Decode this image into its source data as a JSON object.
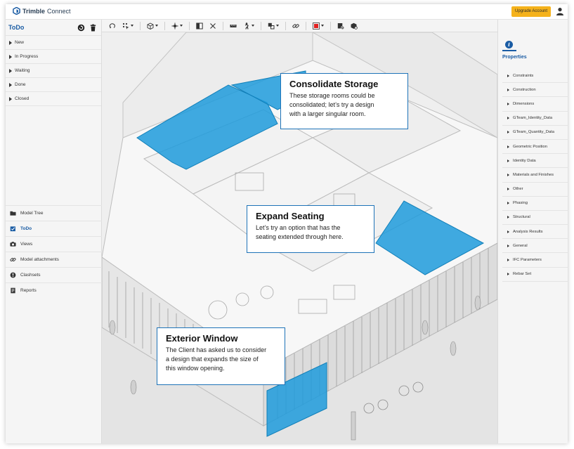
{
  "header": {
    "brand_name": "Trimble",
    "brand_product": "Connect",
    "upgrade_label": "Upgrade Account",
    "accent": "#f5b21b",
    "brand_color": "#1a5ca4"
  },
  "left_panel": {
    "title": "ToDo",
    "header_icons": [
      "refresh-icon",
      "trash-icon"
    ],
    "todo_groups": [
      {
        "label": "New"
      },
      {
        "label": "In Progress"
      },
      {
        "label": "Waiting"
      },
      {
        "label": "Done"
      },
      {
        "label": "Closed"
      }
    ],
    "nav": [
      {
        "label": "Model Tree",
        "icon": "folder-icon"
      },
      {
        "label": "ToDo",
        "icon": "todo-icon",
        "active": true
      },
      {
        "label": "Views",
        "icon": "camera-icon"
      },
      {
        "label": "Model attachments",
        "icon": "link-icon"
      },
      {
        "label": "Clashsets",
        "icon": "clash-icon"
      },
      {
        "label": "Reports",
        "icon": "report-icon"
      }
    ]
  },
  "toolbar": {
    "icons": [
      "orbit-icon",
      "select-icon",
      "cube-icon",
      "center-icon",
      "section-icon",
      "close-icon",
      "measure-icon",
      "walk-icon",
      "markup-icon",
      "link-icon",
      "color-icon",
      "clear-icon",
      "model-icon"
    ],
    "markup_color": "#e02020"
  },
  "viewer": {
    "highlight_color": "#1e9bdc",
    "callouts": [
      {
        "heading": "Consolidate Storage",
        "body": "These storage rooms could be\nconsolidated; let’s try a design\nwith a larger singular room."
      },
      {
        "heading": "Expand Seating",
        "body": "Let’s try an option that has the\nseating extended through here."
      },
      {
        "heading": "Exterior Window",
        "body": "The Client has asked us to consider\na design that expands the size of\nthis window opening."
      }
    ]
  },
  "right_panel": {
    "info_glyph": "i",
    "title": "Properties",
    "items": [
      {
        "label": "Constraints"
      },
      {
        "label": "Construction"
      },
      {
        "label": "Dimensions"
      },
      {
        "label": "GTeam_Identity_Data"
      },
      {
        "label": "GTeam_Quantity_Data"
      },
      {
        "label": "Geometric Position"
      },
      {
        "label": "Identity Data"
      },
      {
        "label": "Materials and Finishes"
      },
      {
        "label": "Other"
      },
      {
        "label": "Phasing"
      },
      {
        "label": "Structural"
      },
      {
        "label": "Analysis Results"
      },
      {
        "label": "General"
      },
      {
        "label": "IFC Parameters"
      },
      {
        "label": "Rebar Set"
      }
    ]
  }
}
